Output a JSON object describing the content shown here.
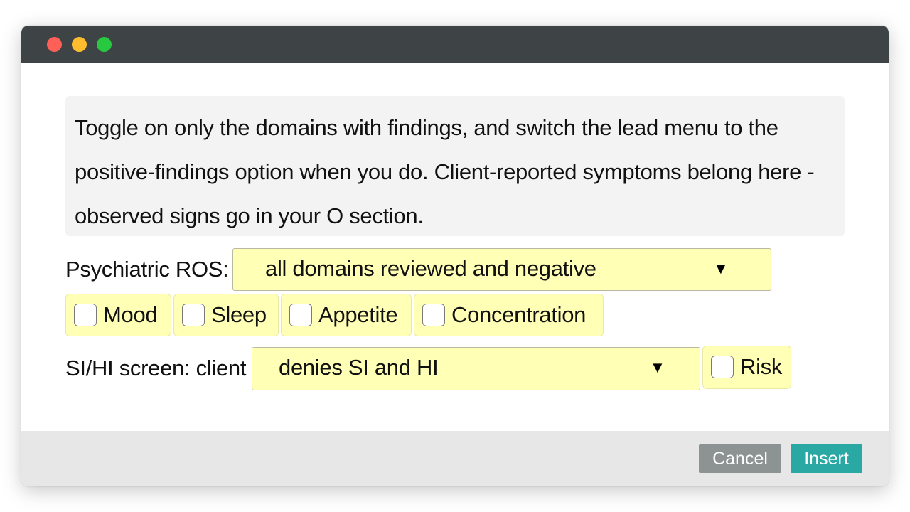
{
  "window": {
    "controls": [
      "close",
      "minimize",
      "maximize"
    ]
  },
  "instructions": {
    "text": "Toggle on only the domains with findings, and switch the lead menu to the positive-findings option when you do. Client-reported symptoms belong here - observed signs go in your O section."
  },
  "ros": {
    "label": "Psychiatric ROS:",
    "selected": "all domains reviewed and negative",
    "arrow_icon": "▼",
    "domains": [
      {
        "label": "Mood",
        "checked": false
      },
      {
        "label": "Sleep",
        "checked": false
      },
      {
        "label": "Appetite",
        "checked": false
      },
      {
        "label": "Concentration",
        "checked": false
      }
    ]
  },
  "si_hi": {
    "label": "SI/HI screen: client",
    "selected": "denies SI and HI",
    "arrow_icon": "▼",
    "risk": {
      "label": "Risk",
      "checked": false
    }
  },
  "footer": {
    "cancel_label": "Cancel",
    "insert_label": "Insert"
  },
  "colors": {
    "titlebar": "#3e4446",
    "field_background": "#ffffb5",
    "cancel_button": "#8d9292",
    "insert_button": "#2aa8a3",
    "footer": "#e7e7e7"
  }
}
